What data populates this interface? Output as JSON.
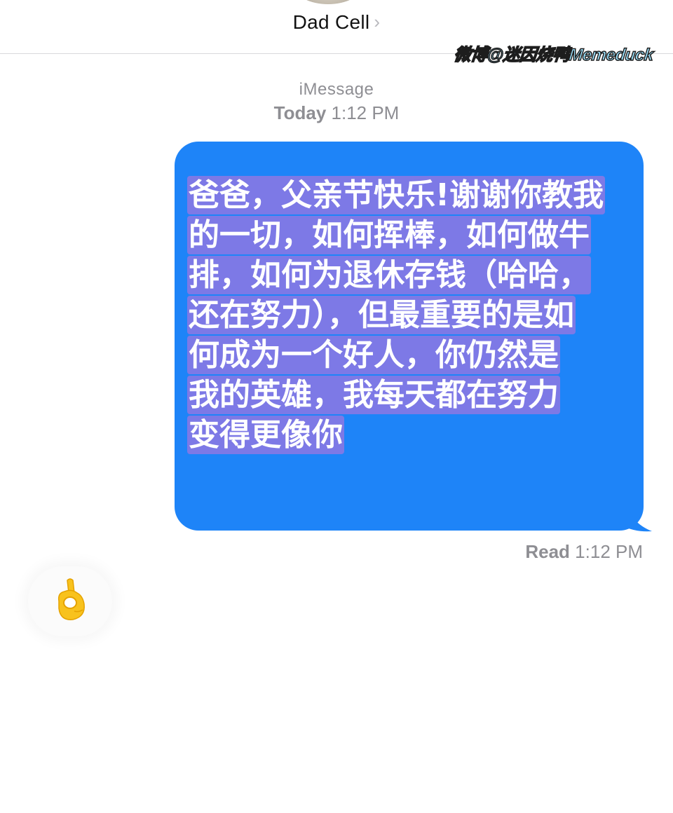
{
  "header": {
    "contact_name": "Dad Cell",
    "chevron_glyph": "›",
    "watermark": "微博@迷因烧鸭Memeduck"
  },
  "thread_meta": {
    "service": "iMessage",
    "day": "Today",
    "time": "1:12 PM"
  },
  "outgoing_message": {
    "lines": [
      "爸爸，父亲节快乐!谢谢你教我",
      "的一切，如何挥棒，如何做牛",
      "排，如何为退休存钱（哈哈，",
      "还在努力），但最重要的是如",
      "何成为一个好人，你仍然是",
      "我的英雄，我每天都在努力",
      "变得更像你"
    ],
    "status_label": "Read",
    "status_time": "1:12 PM"
  },
  "incoming_reply": {
    "content": "ok-hand-emoji"
  },
  "colors": {
    "bubble_blue": "#1e84f8",
    "text_highlight": "#7d79e6",
    "meta_gray": "#8e8e93",
    "emoji_yellow": "#f8c21d"
  }
}
